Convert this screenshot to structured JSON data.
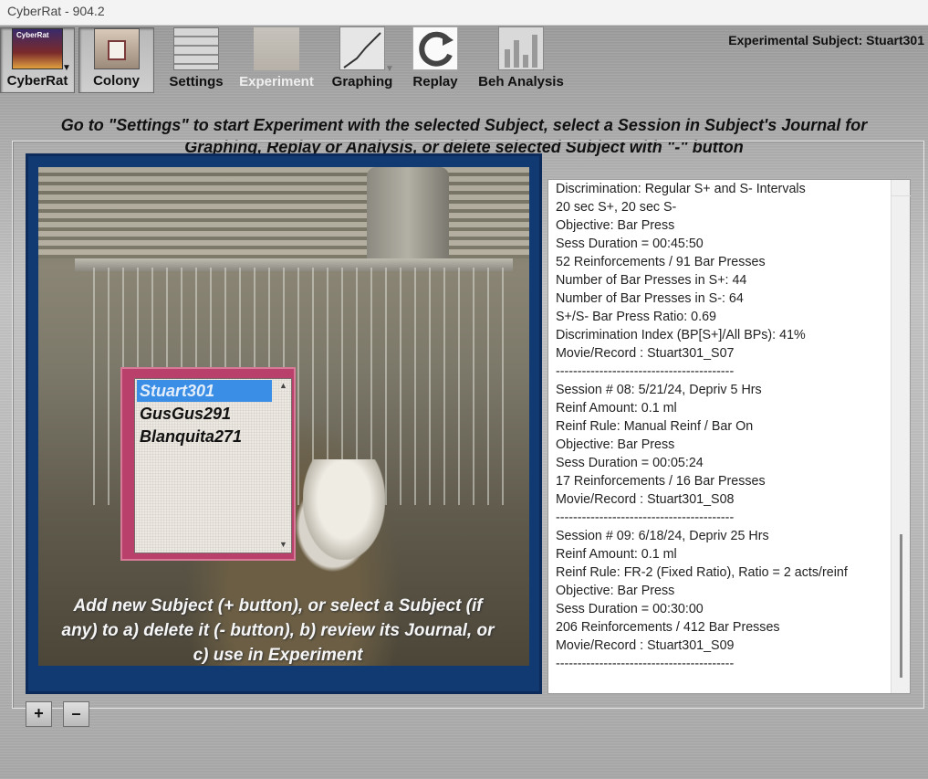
{
  "window": {
    "title": "CyberRat - 904.2"
  },
  "toolbar": {
    "cyberrat_label": "CyberRat",
    "colony_label": "Colony",
    "settings_label": "Settings",
    "experiment_label": "Experiment",
    "graphing_label": "Graphing",
    "replay_label": "Replay",
    "beh_analysis_label": "Beh Analysis",
    "cyberrat_logo_text": "CyberRat"
  },
  "header": {
    "subject_label": "Experimental Subject: Stuart301"
  },
  "instructions": {
    "line1": "Go to \"Settings\" to start Experiment with the selected Subject, select a Session in Subject's Journal for",
    "line2": "Graphing, Replay or Analysis, or delete selected Subject with \"-\" button"
  },
  "subjects": {
    "items": [
      "Stuart301",
      "GusGus291",
      "Blanquita271"
    ],
    "selected_index": 0
  },
  "caption": {
    "line1": "Add new Subject (+ button), or select a Subject (if",
    "line2": "any) to a) delete it (- button), b) review its Journal, or",
    "line3": "c) use in Experiment"
  },
  "journal": {
    "lines": [
      "Discrimination: Regular S+ and S- Intervals",
      "20 sec S+, 20 sec S-",
      "Objective: Bar Press",
      "Sess Duration = 00:45:50",
      "52 Reinforcements / 91 Bar Presses",
      "Number of Bar Presses in S+: 44",
      "Number of Bar Presses in S-: 64",
      "S+/S- Bar Press Ratio: 0.69",
      "Discrimination Index (BP[S+]/All BPs): 41%",
      "Movie/Record : Stuart301_S07",
      "-----------------------------------------",
      "Session # 08: 5/21/24, Depriv 5 Hrs",
      "Reinf Amount: 0.1 ml",
      "Reinf Rule: Manual Reinf / Bar On",
      "Objective: Bar Press",
      "Sess Duration = 00:05:24",
      "17 Reinforcements / 16 Bar Presses",
      "Movie/Record : Stuart301_S08",
      "-----------------------------------------",
      "Session # 09: 6/18/24, Depriv 25 Hrs",
      "Reinf Amount: 0.1 ml",
      "Reinf Rule: FR-2 (Fixed Ratio), Ratio = 2 acts/reinf",
      "Objective: Bar Press",
      "Sess Duration = 00:30:00",
      "206 Reinforcements / 412 Bar Presses",
      "Movie/Record : Stuart301_S09",
      "-----------------------------------------"
    ]
  },
  "buttons": {
    "add_label": "+",
    "remove_label": "–"
  }
}
